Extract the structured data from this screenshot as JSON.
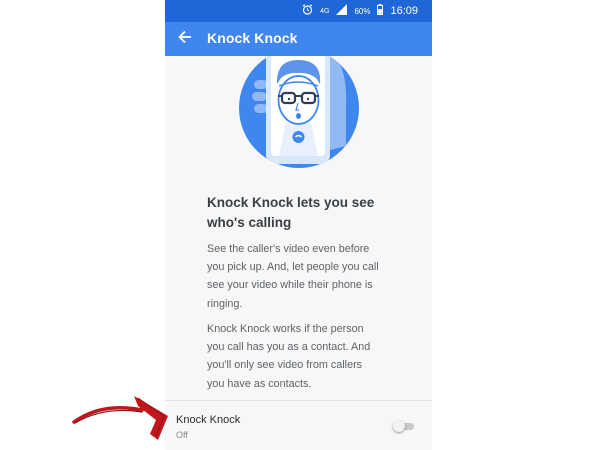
{
  "statusbar": {
    "alarm_icon": "alarm-clock-icon",
    "network_label": "4G",
    "signal_icon": "signal-icon",
    "battery_percent": "60%",
    "battery_icon": "battery-icon",
    "time": "16:09"
  },
  "toolbar": {
    "back_icon": "arrow-left-icon",
    "title": "Knock Knock"
  },
  "main": {
    "illustration": "phone-video-call-illustration",
    "headline_line1": "Knock Knock lets you see",
    "headline_line2": "who's calling",
    "para1_lines": [
      "See the caller's video even before",
      "you pick up. And, let people you call",
      "see your video while their phone is",
      "ringing."
    ],
    "para2_lines": [
      "Knock Knock works if the person",
      "you call has you as a contact. And",
      "you'll only see video from callers",
      "you have as contacts."
    ]
  },
  "setting": {
    "title": "Knock Knock",
    "status": "Off",
    "enabled": false
  },
  "colors": {
    "status_bar": "#1f66d6",
    "toolbar": "#3f86ee",
    "hero_circle": "#3f86ee",
    "annotation_arrow": "#c0161c"
  }
}
